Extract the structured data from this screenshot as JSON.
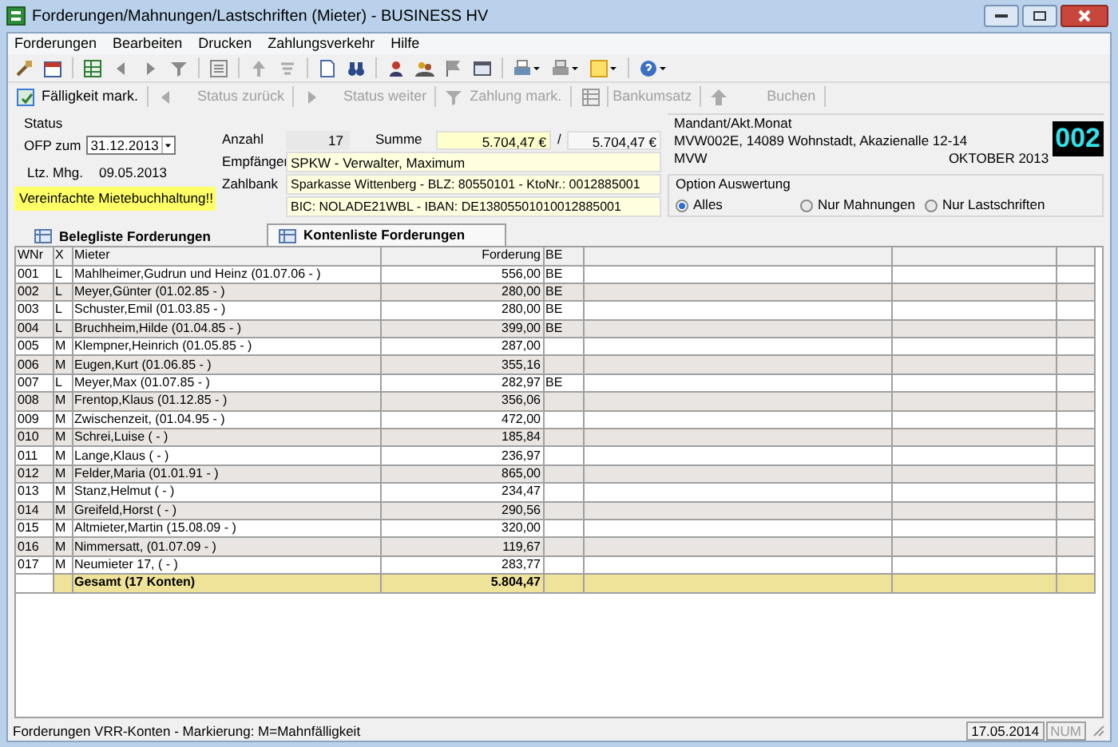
{
  "window": {
    "title": "Forderungen/Mahnungen/Lastschriften (Mieter) - BUSINESS HV"
  },
  "menu": [
    "Forderungen",
    "Bearbeiten",
    "Drucken",
    "Zahlungsverkehr",
    "Hilfe"
  ],
  "action_bar": [
    {
      "label": "Fälligkeit mark.",
      "disabled": false
    },
    {
      "label": "Status zurück",
      "disabled": true
    },
    {
      "label": "Status weiter",
      "disabled": true
    },
    {
      "label": "Zahlung mark.",
      "disabled": true
    },
    {
      "label": "Bankumsatz",
      "disabled": true
    },
    {
      "label": "Buchen",
      "disabled": true
    }
  ],
  "form": {
    "status_label": "Status",
    "ofp_label": "OFP zum",
    "ofp_date": "31.12.2013",
    "ltz_label": "Ltz. Mhg.",
    "ltz_date": "09.05.2013",
    "notice": "Vereinfachte Mietebuchhaltung!!",
    "anzahl_label": "Anzahl",
    "anzahl": "17",
    "summe_label": "Summe",
    "summe": "5.704,47 €",
    "separator": "/",
    "summe_total": "5.704,47 €",
    "empfaenger_label": "Empfänger",
    "empfaenger": "SPKW - Verwalter, Maximum",
    "zahlbank_label": "Zahlbank",
    "zahlbank": "Sparkasse Wittenberg - BLZ: 80550101 - KtoNr.: 0012885001",
    "bic": "BIC: NOLADE21WBL - IBAN: DE13805501010012885001"
  },
  "mandant": {
    "title": "Mandant/Akt.Monat",
    "address": "MVW002E, 14089 Wohnstadt, Akazienalle 12-14",
    "short": "MVW",
    "month": "OKTOBER 2013",
    "number": "002"
  },
  "option": {
    "title": "Option Auswertung",
    "options": [
      {
        "label": "Alles",
        "selected": true
      },
      {
        "label": "Nur Mahnungen",
        "selected": false
      },
      {
        "label": "Nur Lastschriften",
        "selected": false
      }
    ]
  },
  "tabs": [
    {
      "label": "Belegliste Forderungen",
      "selected": false
    },
    {
      "label": "Kontenliste Forderungen",
      "selected": true
    }
  ],
  "table": {
    "columns": [
      "WNr",
      "X",
      "Mieter",
      "Forderung",
      "BE"
    ],
    "rows": [
      {
        "wnr": "001",
        "x": "L",
        "mieter": "Mahlheimer,Gudrun und Heinz (01.07.06 - )",
        "forderung": "556,00",
        "be": "BE"
      },
      {
        "wnr": "002",
        "x": "L",
        "mieter": "Meyer,Günter (01.02.85 - )",
        "forderung": "280,00",
        "be": "BE"
      },
      {
        "wnr": "003",
        "x": "L",
        "mieter": "Schuster,Emil (01.03.85 - )",
        "forderung": "280,00",
        "be": "BE"
      },
      {
        "wnr": "004",
        "x": "L",
        "mieter": "Bruchheim,Hilde (01.04.85 - )",
        "forderung": "399,00",
        "be": "BE"
      },
      {
        "wnr": "005",
        "x": "M",
        "mieter": "Klempner,Heinrich (01.05.85 - )",
        "forderung": "287,00"
      },
      {
        "wnr": "006",
        "x": "M",
        "mieter": "Eugen,Kurt (01.06.85 - )",
        "forderung": "355,16"
      },
      {
        "wnr": "007",
        "x": "L",
        "mieter": "Meyer,Max (01.07.85 - )",
        "forderung": "282,97",
        "be": "BE"
      },
      {
        "wnr": "008",
        "x": "M",
        "mieter": "Frentop,Klaus (01.12.85 - )",
        "forderung": "356,06"
      },
      {
        "wnr": "009",
        "x": "M",
        "mieter": "Zwischenzeit, (01.04.95 - )",
        "forderung": "472,00"
      },
      {
        "wnr": "010",
        "x": "M",
        "mieter": "Schrei,Luise ( - )",
        "forderung": "185,84"
      },
      {
        "wnr": "011",
        "x": "M",
        "mieter": "Lange,Klaus ( - )",
        "forderung": "236,97"
      },
      {
        "wnr": "012",
        "x": "M",
        "mieter": "Felder,Maria (01.01.91 - )",
        "forderung": "865,00"
      },
      {
        "wnr": "013",
        "x": "M",
        "mieter": "Stanz,Helmut ( - )",
        "forderung": "234,47"
      },
      {
        "wnr": "014",
        "x": "M",
        "mieter": "Greifeld,Horst ( - )",
        "forderung": "290,56"
      },
      {
        "wnr": "015",
        "x": "M",
        "mieter": "Altmieter,Martin (15.08.09 - )",
        "forderung": "320,00"
      },
      {
        "wnr": "016",
        "x": "M",
        "mieter": "Nimmersatt, (01.07.09 - )",
        "forderung": "119,67"
      },
      {
        "wnr": "017",
        "x": "M",
        "mieter": "Neumieter 17, ( - )",
        "forderung": "283,77"
      }
    ],
    "total": {
      "label": "Gesamt (17 Konten)",
      "value": "5.804,47"
    }
  },
  "status_bar": {
    "text": "Forderungen VRR-Konten - Markierung: M=Mahnfälligkeit",
    "date": "17.05.2014",
    "num": "NUM"
  }
}
